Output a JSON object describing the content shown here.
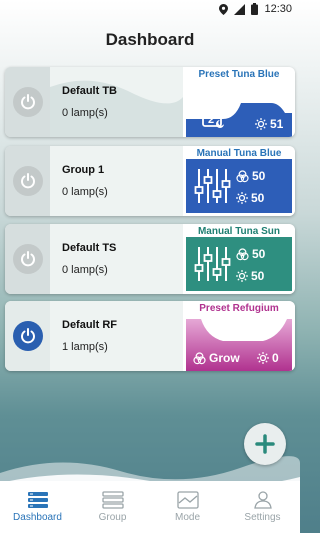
{
  "status": {
    "time": "12:30"
  },
  "title": "Dashboard",
  "cards": [
    {
      "name": "Default TB",
      "lamps": "0 lamp(s)",
      "power_on": false,
      "mode": "Preset Tuna Blue",
      "day": "2",
      "value": "51"
    },
    {
      "name": "Group 1",
      "lamps": "0 lamp(s)",
      "power_on": false,
      "mode": "Manual Tuna Blue",
      "color_value": "50",
      "brightness_value": "50"
    },
    {
      "name": "Default TS",
      "lamps": "0 lamp(s)",
      "power_on": false,
      "mode": "Manual Tuna Sun",
      "color_value": "50",
      "brightness_value": "50"
    },
    {
      "name": "Default RF",
      "lamps": "1 lamp(s)",
      "power_on": true,
      "mode": "Preset Refugium",
      "grow_label": "Grow",
      "value": "0"
    }
  ],
  "nav": [
    {
      "label": "Dashboard",
      "icon": "dashboard-icon",
      "active": true
    },
    {
      "label": "Group",
      "icon": "group-icon",
      "active": false
    },
    {
      "label": "Mode",
      "icon": "mode-icon",
      "active": false
    },
    {
      "label": "Settings",
      "icon": "settings-icon",
      "active": false
    }
  ],
  "colors": {
    "accent": "#2a74b8",
    "blue_panel": "#2d5eb8",
    "teal_panel": "#2e8f80",
    "refugium": "#b0328f"
  }
}
